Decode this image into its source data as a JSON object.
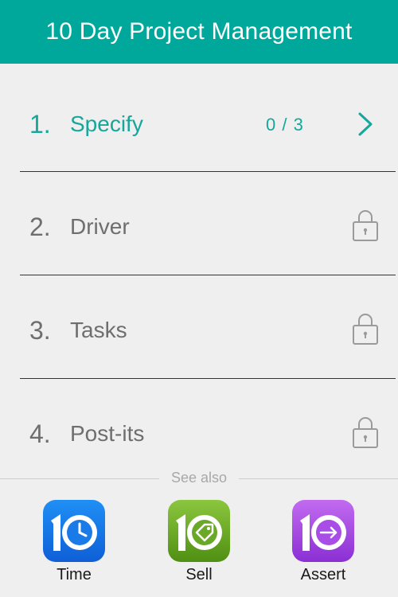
{
  "header": {
    "title": "10 Day Project Management"
  },
  "steps": [
    {
      "number": "1.",
      "label": "Specify",
      "progress": "0 / 3",
      "state": "active",
      "icon": "chevron-right-icon"
    },
    {
      "number": "2.",
      "label": "Driver",
      "state": "locked",
      "icon": "lock-icon"
    },
    {
      "number": "3.",
      "label": "Tasks",
      "state": "locked",
      "icon": "lock-icon"
    },
    {
      "number": "4.",
      "label": "Post-its",
      "state": "locked",
      "icon": "lock-icon"
    }
  ],
  "see_also": {
    "label": "See also",
    "apps": [
      {
        "name": "Time",
        "icon": "clock-icon",
        "color_top": "#1f8ff5",
        "color_bottom": "#0f5fd6"
      },
      {
        "name": "Sell",
        "icon": "price-tag-icon",
        "color_top": "#8cc63f",
        "color_bottom": "#4f8f12"
      },
      {
        "name": "Assert",
        "icon": "arrow-circle-icon",
        "color_top": "#c26bf0",
        "color_bottom": "#8b2fd4"
      }
    ]
  },
  "colors": {
    "accent": "#00a89b",
    "active_text": "#16a79a",
    "inactive_text": "#6e6e6e",
    "background": "#efefef"
  }
}
